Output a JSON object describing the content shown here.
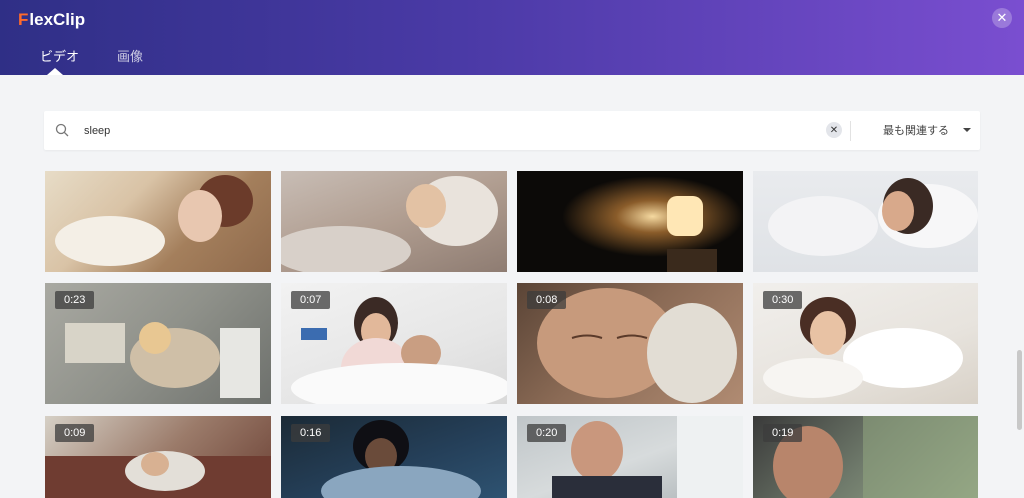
{
  "app": {
    "logo_mark": "F",
    "logo_text": "lexClip"
  },
  "tabs": [
    {
      "label": "ビデオ"
    },
    {
      "label": "画像"
    }
  ],
  "search": {
    "value": "sleep",
    "sort_label": "最も関連する"
  },
  "icons": {
    "close": "close-icon",
    "search": "search-icon",
    "clear": "clear-icon",
    "caret": "chevron-down-icon"
  },
  "colors": {
    "header_start": "#2f2f86",
    "header_end": "#7a4ed0",
    "accent": "#ff6a2b",
    "background": "#f3f4f6"
  },
  "videos": [
    {
      "duration": ""
    },
    {
      "duration": ""
    },
    {
      "duration": ""
    },
    {
      "duration": ""
    },
    {
      "duration": "0:23"
    },
    {
      "duration": "0:07"
    },
    {
      "duration": "0:08"
    },
    {
      "duration": "0:30"
    },
    {
      "duration": "0:09"
    },
    {
      "duration": "0:16"
    },
    {
      "duration": "0:20"
    },
    {
      "duration": "0:19"
    }
  ]
}
